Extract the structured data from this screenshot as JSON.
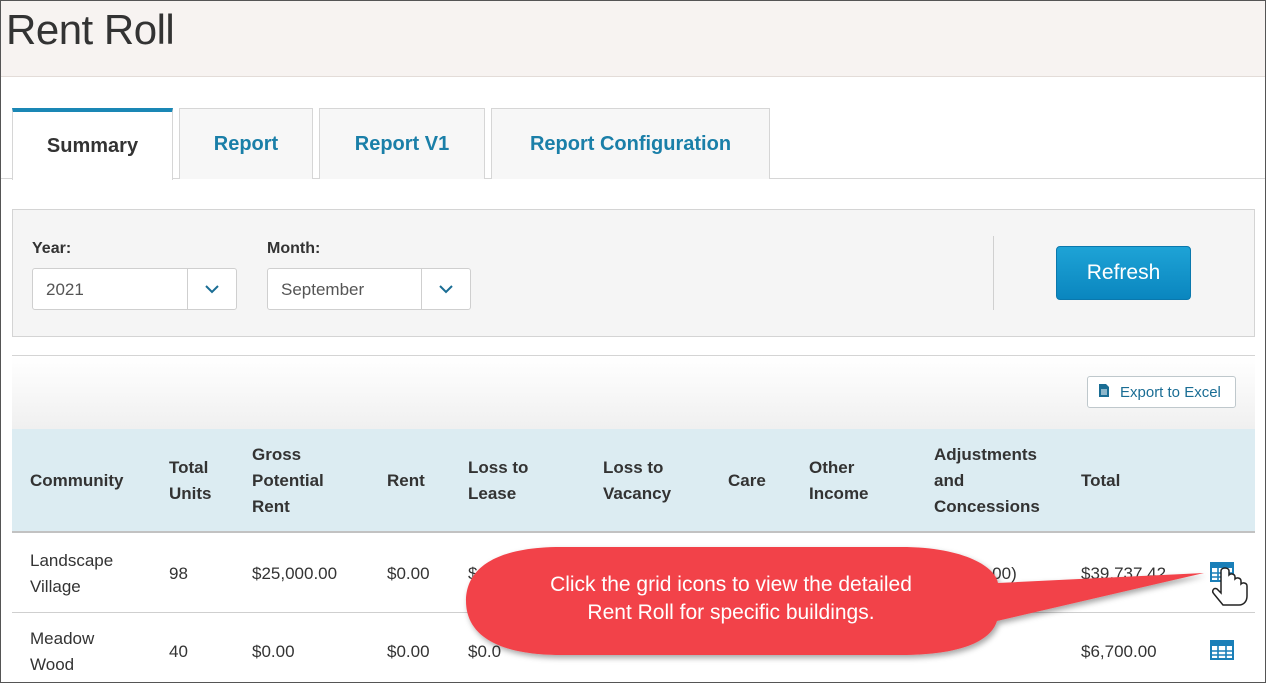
{
  "page": {
    "title": "Rent Roll"
  },
  "tabs": [
    {
      "label": "Summary",
      "active": true
    },
    {
      "label": "Report",
      "active": false
    },
    {
      "label": "Report V1",
      "active": false
    },
    {
      "label": "Report Configuration",
      "active": false
    }
  ],
  "filters": {
    "year_label": "Year:",
    "year_value": "2021",
    "month_label": "Month:",
    "month_value": "September",
    "refresh_label": "Refresh"
  },
  "toolbar": {
    "export_label": "Export to Excel",
    "export_icon": "file-icon"
  },
  "table": {
    "headers": [
      "Community",
      "Total Units",
      "Gross Potential Rent",
      "Rent",
      "Loss to Lease",
      "Loss to Vacancy",
      "Care",
      "Other Income",
      "Adjustments and Concessions",
      "Total"
    ],
    "rows": [
      {
        "community": "Landscape Village",
        "total_units": "98",
        "gpr": "$25,000.00",
        "rent": "$0.00",
        "loss_to_lease": "$",
        "loss_to_vacancy": "",
        "care": "",
        "other_income": "",
        "adjustments": "0.00)",
        "total": "$39,737.42",
        "icon": "grid-icon"
      },
      {
        "community": "Meadow Wood",
        "total_units": "40",
        "gpr": "$0.00",
        "rent": "$0.00",
        "loss_to_lease": "$0.0",
        "loss_to_vacancy": "",
        "care": "",
        "other_income": "",
        "adjustments": "",
        "total": "$6,700.00",
        "icon": "grid-icon"
      }
    ]
  },
  "callout": {
    "text_line1": "Click the grid icons to view the detailed",
    "text_line2": "Rent Roll for specific buildings.",
    "color": "#f2434a"
  },
  "colors": {
    "accent": "#1a87b5",
    "header_bg": "#dcecf2",
    "refresh_bg": "#1191c9"
  }
}
